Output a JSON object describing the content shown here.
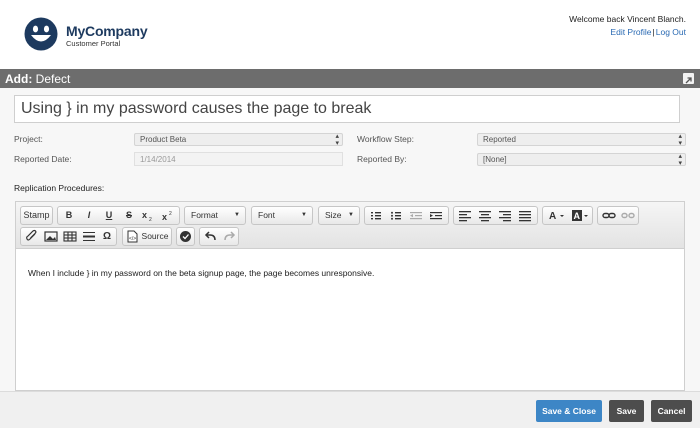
{
  "header": {
    "company_name": "MyCompany",
    "company_sub": "Customer Portal",
    "welcome": "Welcome back Vincent Blanch.",
    "edit_profile": "Edit Profile",
    "separator": "|",
    "logout": "Log Out"
  },
  "titlebar": {
    "prefix": "Add:",
    "entity": "Defect"
  },
  "form": {
    "title_value": "Using } in my password causes the page to break",
    "project_label": "Project:",
    "project_value": "Product Beta",
    "workflow_label": "Workflow Step:",
    "workflow_value": "Reported",
    "reported_date_label": "Reported Date:",
    "reported_date_value": "1/14/2014",
    "reported_by_label": "Reported By:",
    "reported_by_value": "[None]",
    "replication_label": "Replication Procedures:"
  },
  "toolbar": {
    "stamp": "Stamp",
    "bold": "B",
    "italic": "I",
    "underline": "U",
    "strike": "S",
    "format": "Format",
    "font": "Font",
    "size": "Size",
    "source": "Source",
    "omega": "Ω"
  },
  "editor": {
    "body": "When I include } in my password on the beta signup page, the page becomes unresponsive."
  },
  "footer": {
    "save_close": "Save & Close",
    "save": "Save",
    "cancel": "Cancel"
  },
  "colors": {
    "brand": "#1d3a5f",
    "primary_button": "#3d86c6",
    "dark_button": "#4d4d4d",
    "titlebar": "#6d6d6d"
  }
}
